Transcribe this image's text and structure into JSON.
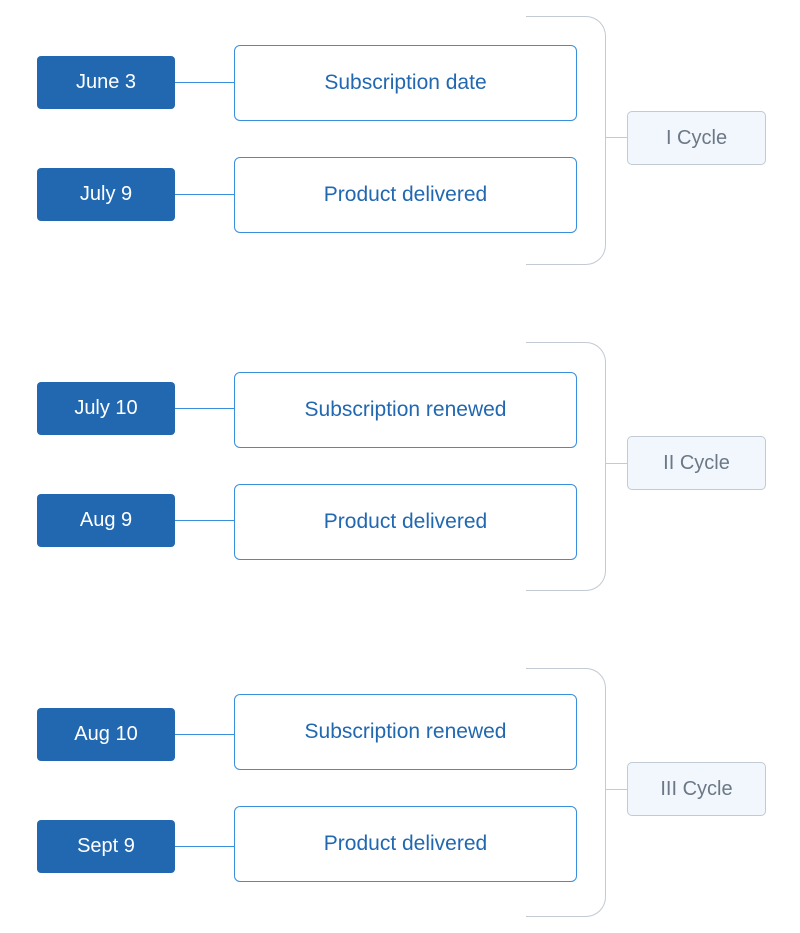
{
  "cycles": [
    {
      "label": "I Cycle",
      "events": [
        {
          "date": "June 3",
          "event": "Subscription date"
        },
        {
          "date": "July 9",
          "event": "Product delivered"
        }
      ]
    },
    {
      "label": "II Cycle",
      "events": [
        {
          "date": "July 10",
          "event": "Subscription renewed"
        },
        {
          "date": "Aug 9",
          "event": "Product delivered"
        }
      ]
    },
    {
      "label": "III Cycle",
      "events": [
        {
          "date": "Aug 10",
          "event": "Subscription renewed"
        },
        {
          "date": "Sept 9",
          "event": "Product delivered"
        }
      ]
    }
  ],
  "colors": {
    "date_fill": "#2268b1",
    "event_border": "#3a8fdc",
    "bracket": "#c2cad3",
    "cycle_fill": "#f1f7fd",
    "cycle_text": "#6c7885"
  }
}
